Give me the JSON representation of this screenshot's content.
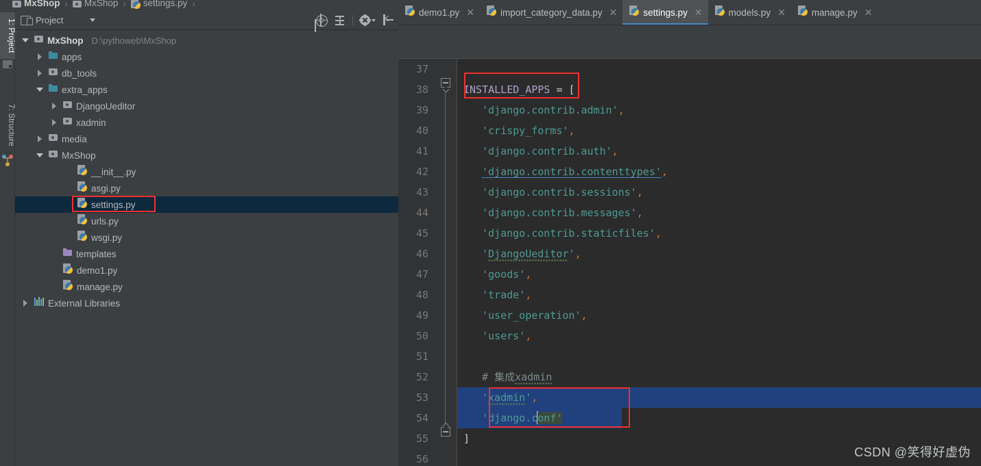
{
  "breadcrumb": {
    "items": [
      {
        "label": "MxShop",
        "icon": "folder-gray-icon",
        "bold": true
      },
      {
        "label": "MxShop",
        "icon": "folder-gray-icon",
        "bold": false
      },
      {
        "label": "settings.py",
        "icon": "python-file-icon",
        "bold": false
      }
    ],
    "separator": "›"
  },
  "tool_tabs": [
    {
      "label": "1: Project",
      "icon": "project-folder-icon",
      "active": true
    },
    {
      "label": "7: Structure",
      "icon": "structure-icon",
      "active": false
    }
  ],
  "project_panel": {
    "title": "Project",
    "title_icon": "project-view-icon",
    "dropdown_icon": "chevron-down-icon",
    "toolbar": [
      {
        "name": "locate-file-icon",
        "tooltip": "Select Opened File"
      },
      {
        "name": "collapse-all-icon",
        "tooltip": "Collapse All"
      },
      {
        "name": "gear-icon",
        "tooltip": "Settings"
      },
      {
        "name": "hide-panel-icon",
        "tooltip": "Hide"
      }
    ],
    "tree": [
      {
        "label": "MxShop",
        "path": "D:\\pythoweb\\MxShop",
        "icon": "folder-gray-icon",
        "arrow": "down",
        "indent": 0,
        "bold": true,
        "selected": false
      },
      {
        "label": "apps",
        "path": "",
        "icon": "folder-source-icon",
        "arrow": "right",
        "indent": 1,
        "bold": false,
        "selected": false
      },
      {
        "label": "db_tools",
        "path": "",
        "icon": "folder-gray-icon",
        "arrow": "right",
        "indent": 1,
        "bold": false,
        "selected": false
      },
      {
        "label": "extra_apps",
        "path": "",
        "icon": "folder-source-icon",
        "arrow": "down",
        "indent": 1,
        "bold": false,
        "selected": false
      },
      {
        "label": "DjangoUeditor",
        "path": "",
        "icon": "folder-gray-icon",
        "arrow": "right",
        "indent": 2,
        "bold": false,
        "selected": false
      },
      {
        "label": "xadmin",
        "path": "",
        "icon": "folder-gray-icon",
        "arrow": "right",
        "indent": 2,
        "bold": false,
        "selected": false
      },
      {
        "label": "media",
        "path": "",
        "icon": "folder-gray-icon",
        "arrow": "right",
        "indent": 1,
        "bold": false,
        "selected": false
      },
      {
        "label": "MxShop",
        "path": "",
        "icon": "folder-gray-icon",
        "arrow": "down",
        "indent": 1,
        "bold": false,
        "selected": false
      },
      {
        "label": "__init__.py",
        "path": "",
        "icon": "python-file-icon",
        "arrow": "none",
        "indent": 3,
        "bold": false,
        "selected": false
      },
      {
        "label": "asgi.py",
        "path": "",
        "icon": "python-file-icon",
        "arrow": "none",
        "indent": 3,
        "bold": false,
        "selected": false
      },
      {
        "label": "settings.py",
        "path": "",
        "icon": "python-file-icon",
        "arrow": "none",
        "indent": 3,
        "bold": false,
        "selected": true
      },
      {
        "label": "urls.py",
        "path": "",
        "icon": "python-file-icon",
        "arrow": "none",
        "indent": 3,
        "bold": false,
        "selected": false
      },
      {
        "label": "wsgi.py",
        "path": "",
        "icon": "python-file-icon",
        "arrow": "none",
        "indent": 3,
        "bold": false,
        "selected": false
      },
      {
        "label": "templates",
        "path": "",
        "icon": "folder-template-icon",
        "arrow": "none",
        "indent": 2,
        "bold": false,
        "selected": false
      },
      {
        "label": "demo1.py",
        "path": "",
        "icon": "python-file-icon",
        "arrow": "none",
        "indent": 2,
        "bold": false,
        "selected": false
      },
      {
        "label": "manage.py",
        "path": "",
        "icon": "python-file-icon",
        "arrow": "none",
        "indent": 2,
        "bold": false,
        "selected": false
      },
      {
        "label": "External Libraries",
        "path": "",
        "icon": "libraries-icon",
        "arrow": "right",
        "indent": 0,
        "bold": false,
        "selected": false
      }
    ]
  },
  "editor": {
    "tabs": [
      {
        "label": "demo1.py",
        "icon": "python-file-icon",
        "active": false,
        "close_icon": "close-icon"
      },
      {
        "label": "import_category_data.py",
        "icon": "python-file-icon",
        "active": false,
        "close_icon": "close-icon"
      },
      {
        "label": "settings.py",
        "icon": "python-file-icon",
        "active": true,
        "close_icon": "close-icon"
      },
      {
        "label": "models.py",
        "icon": "python-file-icon",
        "active": false,
        "close_icon": "close-icon"
      },
      {
        "label": "manage.py",
        "icon": "python-file-icon",
        "active": false,
        "close_icon": "close-icon"
      }
    ],
    "first_line_number": 37,
    "lines": [
      {
        "num": "37",
        "text": "",
        "selected": false
      },
      {
        "num": "38",
        "text": "INSTALLED_APPS = [",
        "selected": false
      },
      {
        "num": "39",
        "text": "    'django.contrib.admin',",
        "selected": false
      },
      {
        "num": "40",
        "text": "    'crispy_forms',",
        "selected": false
      },
      {
        "num": "41",
        "text": "    'django.contrib.auth',",
        "selected": false
      },
      {
        "num": "42",
        "text": "    'django.contrib.contenttypes',",
        "selected": false
      },
      {
        "num": "43",
        "text": "    'django.contrib.sessions',",
        "selected": false
      },
      {
        "num": "44",
        "text": "    'django.contrib.messages',",
        "selected": false
      },
      {
        "num": "45",
        "text": "    'django.contrib.staticfiles',",
        "selected": false
      },
      {
        "num": "46",
        "text": "    'DjangoUeditor',",
        "selected": false
      },
      {
        "num": "47",
        "text": "    'goods',",
        "selected": false
      },
      {
        "num": "48",
        "text": "    'trade',",
        "selected": false
      },
      {
        "num": "49",
        "text": "    'user_operation',",
        "selected": false
      },
      {
        "num": "50",
        "text": "    'users',",
        "selected": false
      },
      {
        "num": "51",
        "text": "",
        "selected": false
      },
      {
        "num": "52",
        "text": "    # 集成xadmin",
        "selected": false
      },
      {
        "num": "53",
        "text": "    'xadmin',",
        "selected": true
      },
      {
        "num": "54",
        "text": "    'django.conf'",
        "selected": true
      },
      {
        "num": "55",
        "text": "]",
        "selected": false
      },
      {
        "num": "56",
        "text": "",
        "selected": false
      }
    ],
    "comment_text": "# 集成xadmin",
    "annotations": [
      {
        "name": "installed-apps-highlight",
        "target": "line-38"
      },
      {
        "name": "added-apps-highlight",
        "target": "line-53-54"
      },
      {
        "name": "settings-file-highlight",
        "target": "tree-settings-py"
      }
    ]
  },
  "watermark": "CSDN @笑得好虚伪",
  "colors": {
    "accent_blue": "#4a88c7",
    "selection_blue": "#21417e",
    "annotation_red": "#f2302f",
    "string_teal": "#4e9a92",
    "variable_purple": "#b1a1c8",
    "comma_orange": "#cc7832",
    "comment_gray": "#7e8b8a",
    "panel_bg": "#3c3f41",
    "editor_bg": "#2b2b2b",
    "tree_selected": "#0d293e"
  }
}
